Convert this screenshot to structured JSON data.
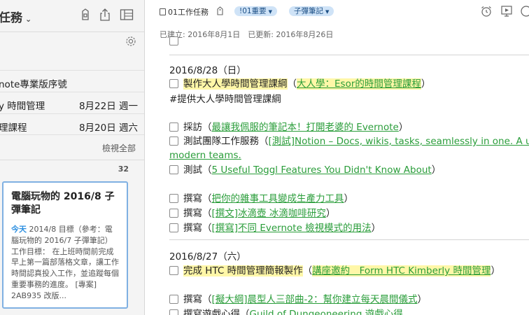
{
  "left": {
    "notebook_title": "任務",
    "reminders": [
      {
        "title": "note專業版序號",
        "date": ""
      },
      {
        "title": "y 時間管理",
        "date": "8月22日 週一"
      },
      {
        "title": "理課程",
        "date": "8月20日 週六"
      }
    ],
    "view_all": "檢視全部",
    "note_count": "32",
    "card": {
      "title": "電腦玩物的 2016/8 子彈筆記",
      "date": "今天",
      "snippet": " 2014/8 目標（參考：電腦玩物的 2016/7 子彈筆記） 工作目標： 在上班時間前完成早上第一篇部落格文章，讓工作時間認真投入工作，並追蹤每個重要事務的進度。 [專案] 2AB935 改版..."
    }
  },
  "right": {
    "notebook": "01工作任務",
    "tags": [
      "!01重要",
      "子彈筆記"
    ],
    "created": "已建立: 2016年8月1日",
    "updated": "已更新: 2016年8月26日",
    "sections": {
      "d1": "2016/8/28（日）",
      "t1_text": "製作大人學時間管理課綱",
      "t1_open": "（",
      "t1_link": "大人學：Esor的時間管理課程",
      "t1_close": "）",
      "hashtag": "#提供大人學時間管理課綱",
      "t2_text": "採訪（",
      "t2_link": "最讓我佩服的筆記本！打開老婆的 Evernote",
      "t2_close": "）",
      "t3_text": "測試團隊工作服務（",
      "t3_link": "[測試]Notion – Docs, wikis, tasks, seamlessly in one. A unified workspace for",
      "t3_link2": "modern teams.",
      "t4_text": "測試（",
      "t4_link": "5 Useful Toggl Features You Didn't Know About",
      "t4_close": "）",
      "t5_text": "撰寫（",
      "t5_link": "把你的雜事工具變成生產力工具",
      "t5_close": "）",
      "t6_text": "撰寫（",
      "t6_link": "[撰文]冰滴壺 冰滴咖啡研究",
      "t6_close": "）",
      "t7_text": "撰寫（",
      "t7_link": "[撰寫]不同 Evernote 檢視模式的用法",
      "t7_close": "）",
      "d2": "2016/8/27（六）",
      "t8_text": "完成 HTC 時間管理簡報製作",
      "t8_open": "（",
      "t8_link": "講座邀約＿Form HTC Kimberly 時間管理",
      "t8_close": "）",
      "t9_text": "撰寫（",
      "t9_link": "[擬大綱]晨型人三部曲-2：幫你建立每天晨間儀式",
      "t9_close": "）",
      "t10_text": "撰寫遊戲心得（",
      "t10_link": "Guild of Dungeoneering 遊戲心得"
    }
  }
}
